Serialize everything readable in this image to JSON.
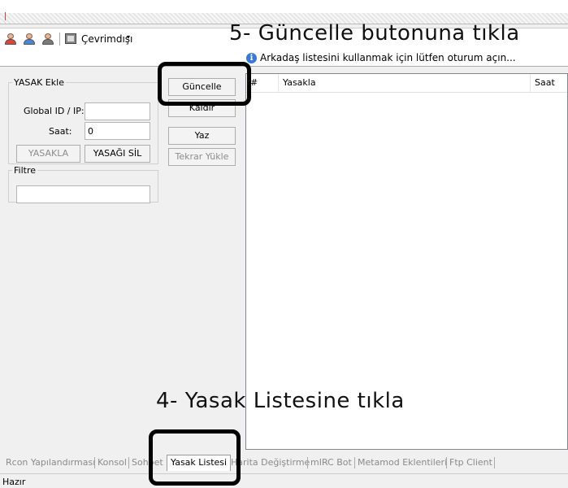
{
  "toolbar": {
    "status_label": "Çevrimdışı",
    "caret": "▾"
  },
  "info": {
    "message": "Arkadaş listesini kullanmak için lütfen oturum açın..."
  },
  "annotations": {
    "step5": "5- Güncelle butonuna tıkla",
    "step4": "4- Yasak Listesine tıkla"
  },
  "ban_group": {
    "title": "YASAK Ekle",
    "id_label": "Global ID / IP:",
    "id_value": "",
    "time_label": "Saat:",
    "time_value": "0",
    "ban_button": "YASAKLA",
    "unban_button": "YASAĞI SİL"
  },
  "filter_group": {
    "title": "Filtre",
    "value": ""
  },
  "actions": {
    "update": "Güncelle",
    "remove": "Kaldır",
    "write": "Yaz",
    "reload": "Tekrar Yükle"
  },
  "list": {
    "columns": [
      "#",
      "Yasakla",
      "Saat"
    ]
  },
  "tabs": [
    {
      "label": "Rcon Yapılandırması",
      "active": false
    },
    {
      "label": "Konsol",
      "active": false
    },
    {
      "label": "Sohbet",
      "active": false
    },
    {
      "label": "Yasak Listesi",
      "active": true
    },
    {
      "label": "Harita Değiştirme",
      "active": false
    },
    {
      "label": "mIRC Bot",
      "active": false
    },
    {
      "label": "Metamod Eklentileri",
      "active": false
    },
    {
      "label": "Ftp Client",
      "active": false
    }
  ],
  "status": {
    "text": "Hazır"
  },
  "colors": {
    "annotation_box": "#000000",
    "info_icon": "#3a78d6"
  }
}
